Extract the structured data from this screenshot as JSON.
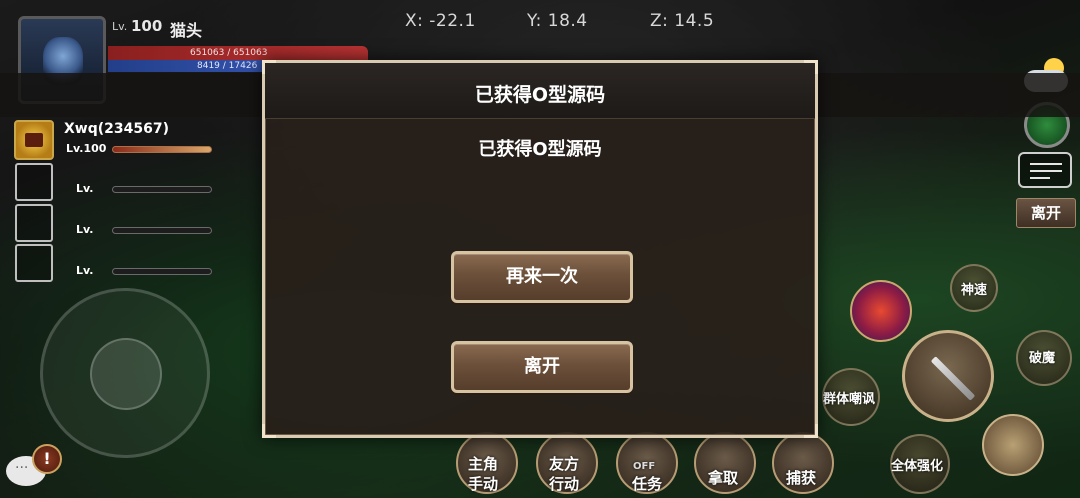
{
  "player": {
    "lv_prefix": "Lv.",
    "level": "100",
    "name": "猫头",
    "hp_text": "651063 / 651063",
    "mp_text": "8419 / 17426"
  },
  "coords": {
    "x": "X: -22.1",
    "y": "Y: 18.4",
    "z": "Z: 14.5"
  },
  "team": {
    "leader_name": "Xwq(234567)",
    "leader_level": "Lv.100",
    "empty_level_label": "Lv."
  },
  "right_panel": {
    "leave_label": "离开"
  },
  "skills": {
    "speed": "神速",
    "break": "破魔",
    "taunt": "群体嘲讽",
    "buff": "全体强化"
  },
  "bottom_bar": {
    "protagonist_action": "主角\n手动",
    "ally_action": "友方\n行动",
    "task": "任务",
    "task_badge": "OFF",
    "take": "拿取",
    "capture": "捕获"
  },
  "modal": {
    "title": "已获得O型源码",
    "message": "已获得O型源码",
    "retry_label": "再来一次",
    "leave_label": "离开"
  },
  "colors": {
    "hp": "#b33333",
    "mp": "#3c5dbe",
    "modal_border": "#d9cbb2",
    "button_fill": "#6c503a"
  }
}
